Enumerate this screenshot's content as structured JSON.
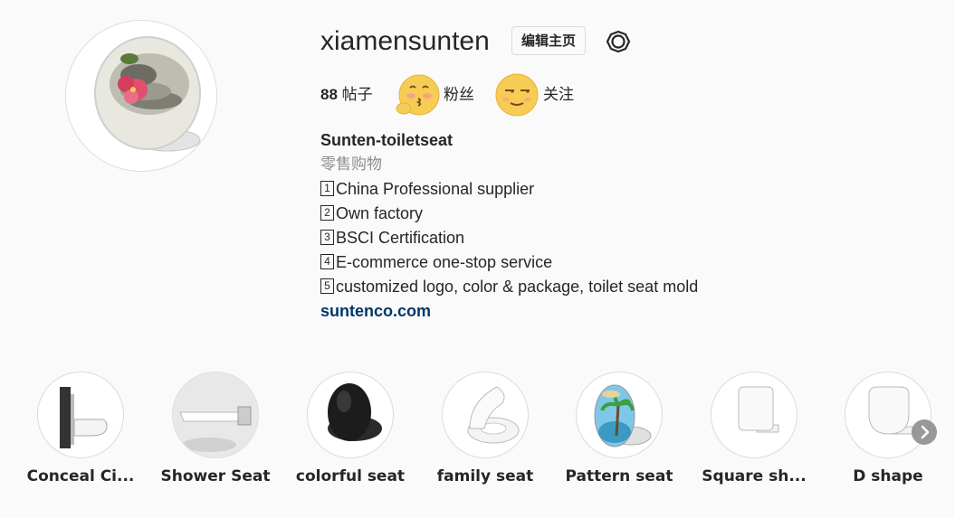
{
  "profile": {
    "username": "xiamensunten",
    "edit_button_label": "编辑主页",
    "stats": {
      "posts_count": "88",
      "posts_label": "帖子",
      "followers_label": "粉丝",
      "following_label": "关注"
    },
    "bio": {
      "name": "Sunten-toiletseat",
      "category": "零售购物",
      "lines": [
        {
          "num": "1",
          "text": "China Professional supplier"
        },
        {
          "num": "2",
          "text": "Own factory"
        },
        {
          "num": "3",
          "text": "BSCI Certification"
        },
        {
          "num": "4",
          "text": "E-commerce one-stop service"
        },
        {
          "num": "5",
          "text": "customized logo, color & package, toilet seat mold"
        }
      ],
      "website": "suntenco.com"
    }
  },
  "highlights": [
    {
      "label": "Conceal Ci...",
      "icon": "wall-toilet-image"
    },
    {
      "label": "Shower Seat",
      "icon": "shower-seat-image"
    },
    {
      "label": "colorful seat",
      "icon": "black-seat-image"
    },
    {
      "label": "family seat",
      "icon": "family-seat-image"
    },
    {
      "label": "Pattern seat",
      "icon": "pattern-seat-image"
    },
    {
      "label": "Square sh...",
      "icon": "square-seat-image"
    },
    {
      "label": "D shape",
      "icon": "d-shape-seat-image"
    }
  ],
  "icons": {
    "settings": "gear-icon",
    "followers_emoji": "blushing-kiss-emoji",
    "following_emoji": "smirk-emoji",
    "next": "chevron-right-icon"
  },
  "colors": {
    "link": "#00376b",
    "muted": "#8e8e8e",
    "border": "#dbdbdb",
    "background": "#fafafa"
  }
}
